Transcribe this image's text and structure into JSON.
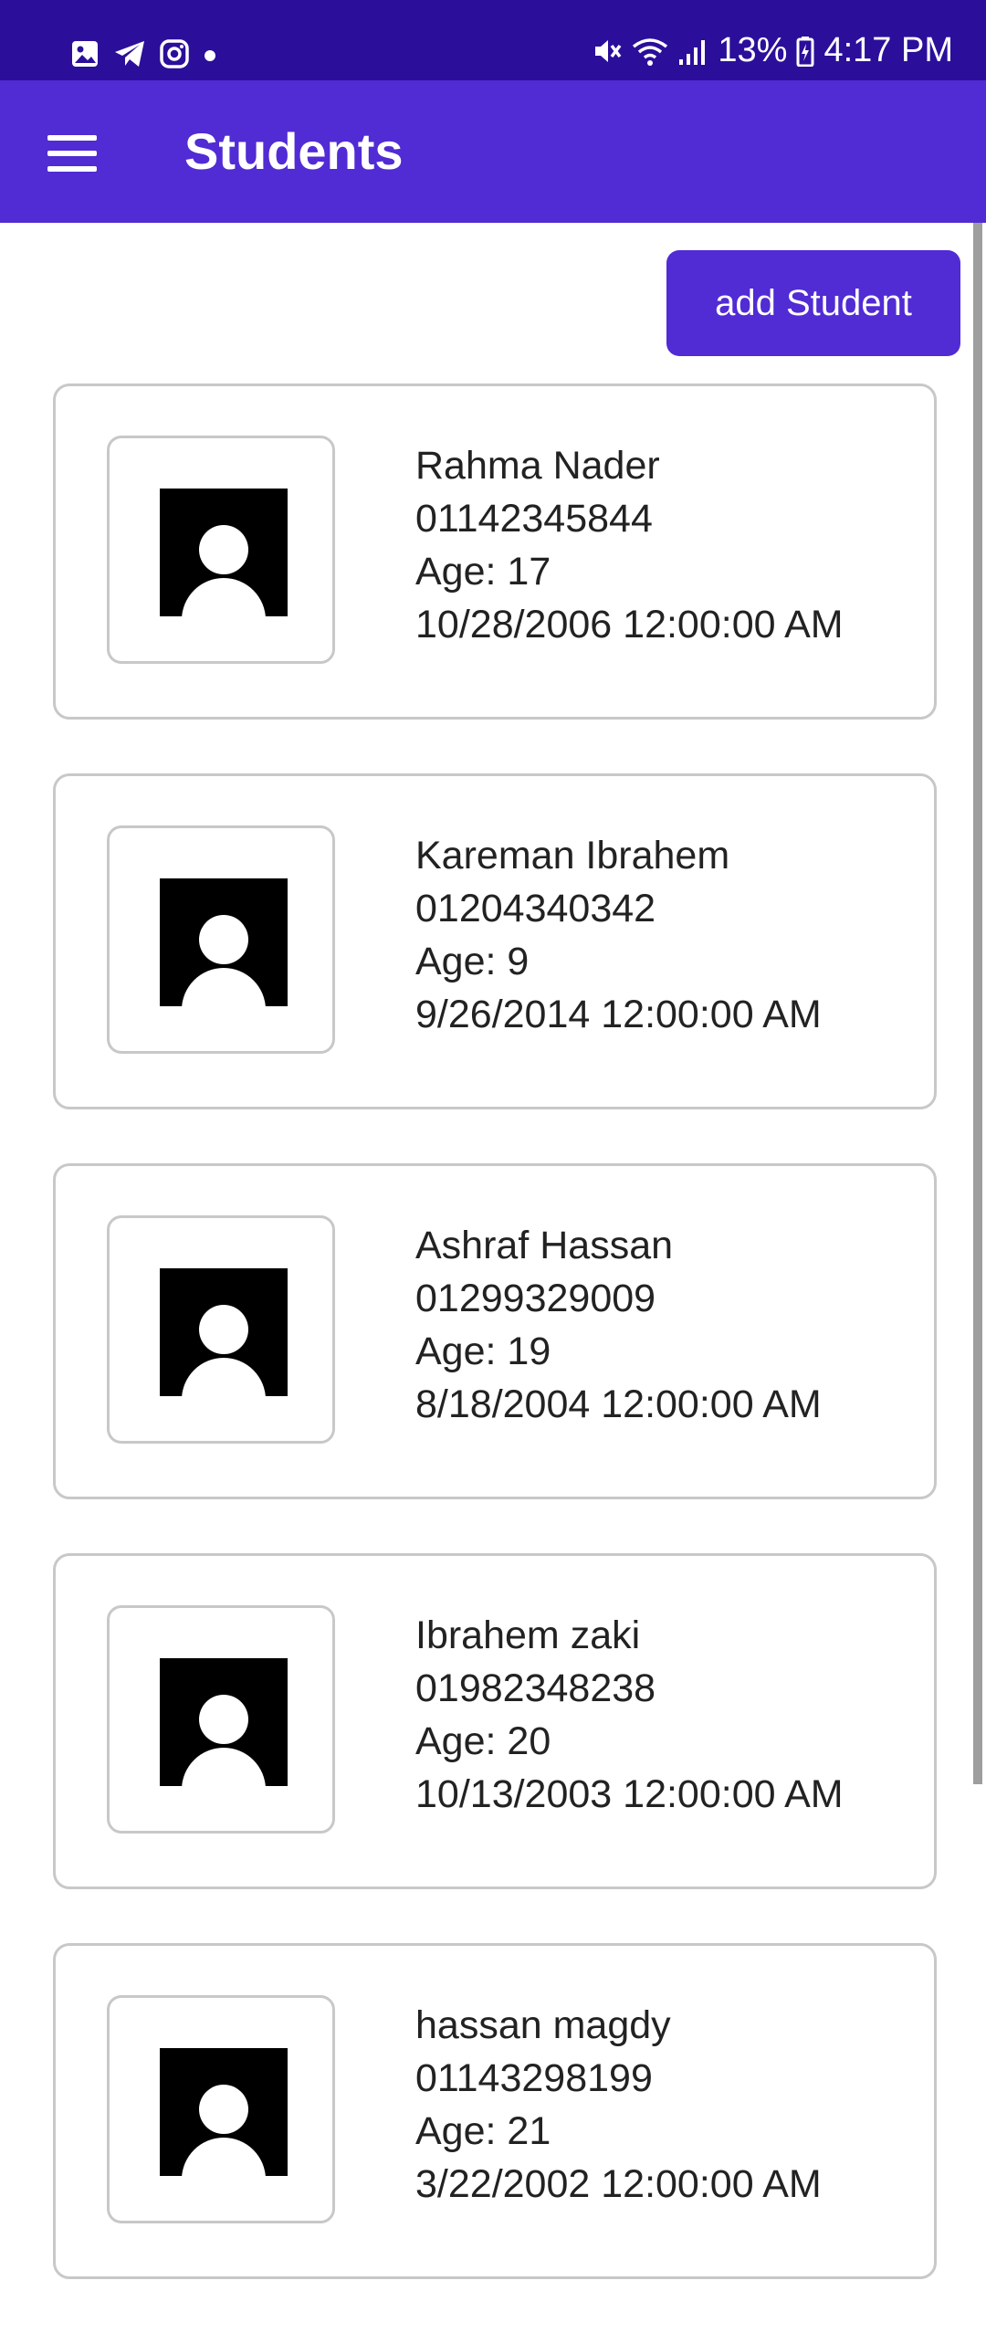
{
  "status_bar": {
    "battery": "13%",
    "time": "4:17 PM"
  },
  "app_bar": {
    "title": "Students"
  },
  "actions": {
    "add_label": "add Student"
  },
  "students": [
    {
      "name": "Rahma Nader",
      "phone": "01142345844",
      "age_label": "Age: 17",
      "birth": "10/28/2006 12:00:00 AM"
    },
    {
      "name": "Kareman Ibrahem",
      "phone": "01204340342",
      "age_label": "Age: 9",
      "birth": "9/26/2014 12:00:00 AM"
    },
    {
      "name": "Ashraf Hassan",
      "phone": "01299329009",
      "age_label": "Age: 19",
      "birth": "8/18/2004 12:00:00 AM"
    },
    {
      "name": "Ibrahem zaki",
      "phone": "01982348238",
      "age_label": "Age: 20",
      "birth": "10/13/2003 12:00:00 AM"
    },
    {
      "name": "hassan magdy",
      "phone": "01143298199",
      "age_label": "Age: 21",
      "birth": "3/22/2002 12:00:00 AM"
    }
  ],
  "colors": {
    "status_bar": "#2b0f9a",
    "primary": "#512bd4",
    "card_border": "#c8c8c8"
  },
  "icons": [
    "gallery-icon",
    "telegram-icon",
    "instagram-icon",
    "dot-icon",
    "mute-icon",
    "wifi-icon",
    "signal-icon",
    "battery-charging-icon",
    "hamburger-menu-icon",
    "avatar-placeholder-icon"
  ]
}
